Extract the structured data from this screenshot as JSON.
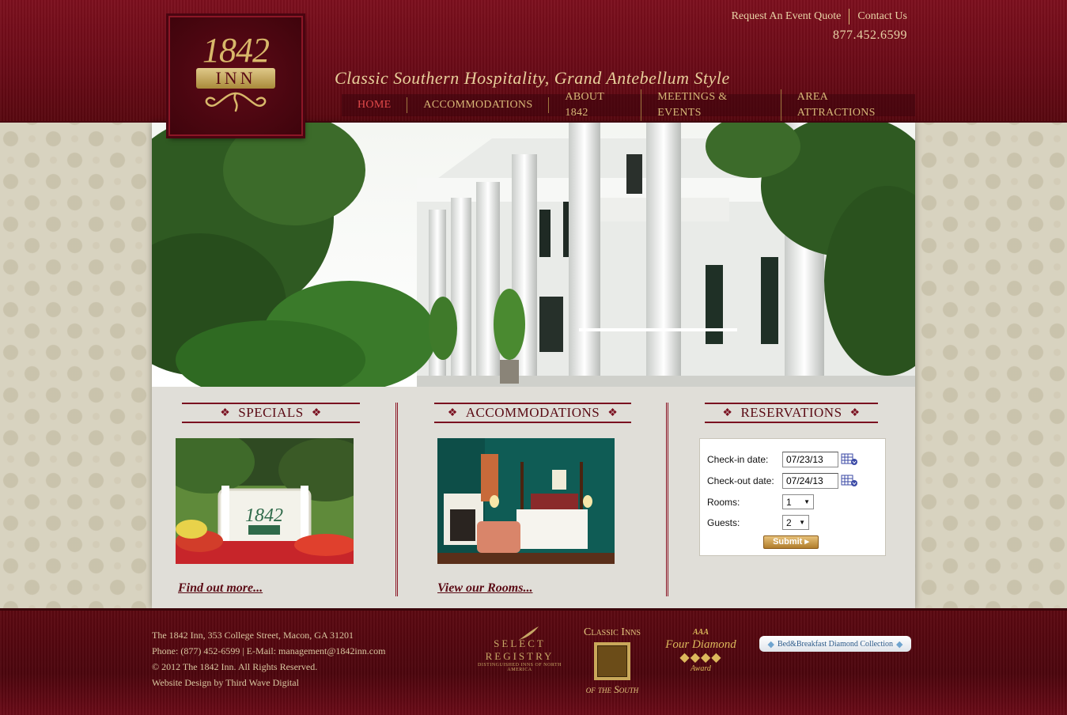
{
  "header": {
    "top_links": [
      "Request An Event Quote",
      "Contact Us"
    ],
    "phone": "877.452.6599",
    "logo": {
      "year": "1842",
      "name": "INN"
    },
    "tagline": "Classic Southern Hospitality, Grand Antebellum Style",
    "nav": [
      "HOME",
      "ACCOMMODATIONS",
      "ABOUT 1842",
      "MEETINGS & EVENTS",
      "AREA ATTRACTIONS"
    ],
    "active_nav": "HOME"
  },
  "specials": {
    "title": "SPECIALS",
    "link": "Find out more..."
  },
  "accommodations": {
    "title": "ACCOMMODATIONS",
    "link": "View our Rooms..."
  },
  "reservations": {
    "title": "RESERVATIONS",
    "checkin_label": "Check-in date:",
    "checkin_value": "07/23/13",
    "checkout_label": "Check-out date:",
    "checkout_value": "07/24/13",
    "rooms_label": "Rooms:",
    "rooms_value": "1",
    "guests_label": "Guests:",
    "guests_value": "2",
    "submit_label": "Submit"
  },
  "footer": {
    "address": "The 1842 Inn, 353 College Street, Macon, GA 31201",
    "contact": "Phone: (877) 452-6599 | E-Mail: management@1842inn.com",
    "copyright": "© 2012 The 1842 Inn. All Rights Reserved.",
    "credit": "Website Design by Third Wave Digital",
    "badges": {
      "select_registry": "SELECT REGISTRY",
      "select_registry_sub": "DISTINGUISHED INNS OF NORTH AMERICA",
      "classic_top": "Classic Inns",
      "classic_bottom": "of the South",
      "aaa": "AAA",
      "four_diamond": "Four Diamond",
      "award": "Award",
      "bb": "Bed&Breakfast Diamond Collection"
    }
  },
  "colors": {
    "header_red": "#6a0a17",
    "gold": "#d9b978",
    "active_nav": "#e24a4a",
    "title_maroon": "#5a0a14"
  }
}
